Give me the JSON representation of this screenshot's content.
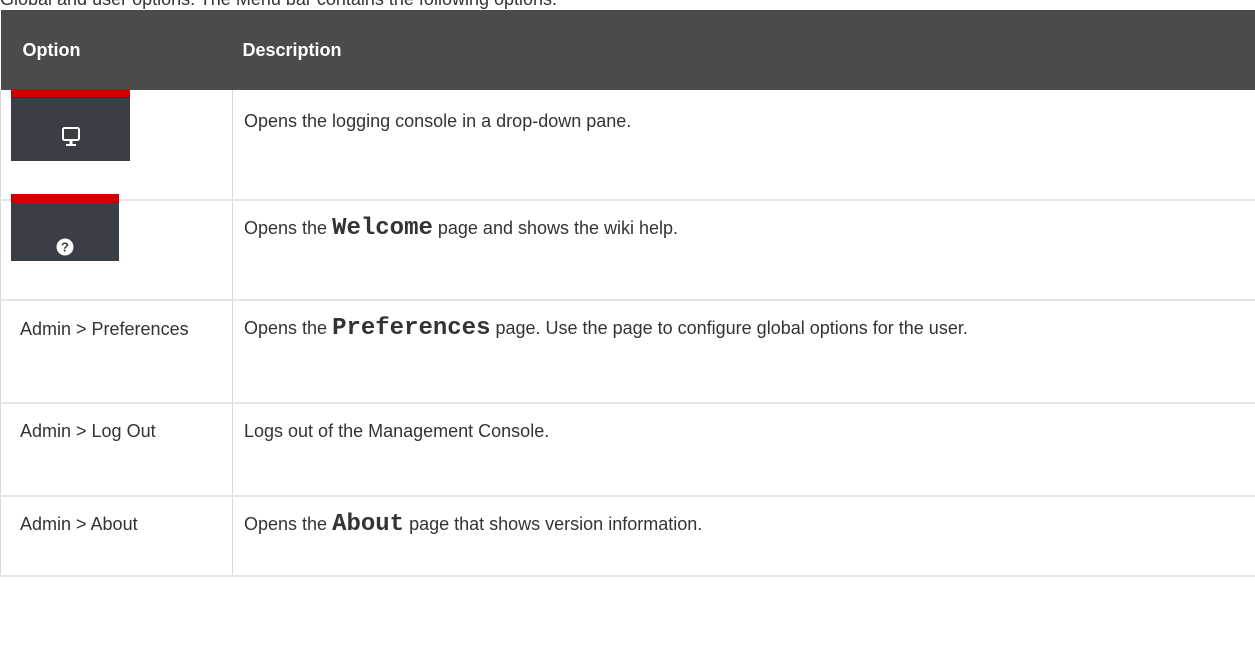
{
  "intro_text": "Global and user options. The Menu bar contains the following options:",
  "table": {
    "headers": {
      "option": "Option",
      "description": "Description"
    },
    "rows": [
      {
        "option_icon": "monitor-icon",
        "description": "Opens the logging console in a drop-down pane."
      },
      {
        "option_icon": "help-icon",
        "desc_before": "Opens the ",
        "desc_keyword": "Welcome",
        "desc_after": " page and shows the wiki help."
      },
      {
        "option": "Admin > Preferences",
        "desc_before": "Opens the ",
        "desc_keyword": "Preferences",
        "desc_after": " page. Use the page to configure global options for the user."
      },
      {
        "option": "Admin > Log Out",
        "description": "Logs out of the Management Console."
      },
      {
        "option": "Admin > About",
        "desc_before": "Opens the ",
        "desc_keyword": "About",
        "desc_after": " page that shows version information."
      }
    ]
  },
  "colors": {
    "header_bg": "#4b4b4b",
    "header_text": "#ffffff",
    "button_bg": "#393f44",
    "button_accent": "#cc0000"
  }
}
